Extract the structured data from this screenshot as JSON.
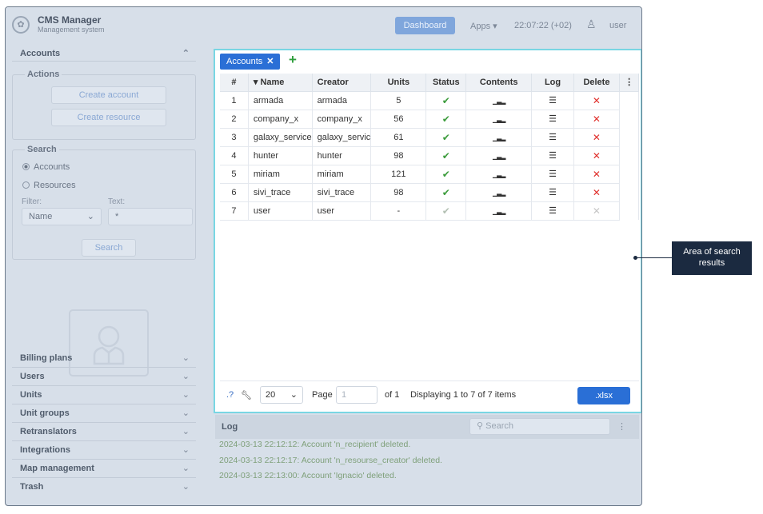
{
  "header": {
    "logo": "✿",
    "app_title": "CMS Manager",
    "app_subtitle": "Management system",
    "dashboard_label": "Dashboard",
    "apps_label": "Apps",
    "time": "22:07:22 (+02)",
    "user_name": "user"
  },
  "sidebar": {
    "accounts_label": "Accounts",
    "actions_legend": "Actions",
    "create_account": "Create account",
    "create_resource": "Create resource",
    "search_legend": "Search",
    "radio_accounts": "Accounts",
    "radio_resources": "Resources",
    "filter_label": "Filter:",
    "text_label": "Text:",
    "filter_value": "Name",
    "text_value": "*",
    "search_button": "Search",
    "nav": [
      "Billing plans",
      "Users",
      "Units",
      "Unit groups",
      "Retranslators",
      "Integrations",
      "Map management",
      "Trash"
    ]
  },
  "main": {
    "tab_label": "Accounts",
    "columns": [
      "#",
      "Name",
      "Creator",
      "Units",
      "Status",
      "Contents",
      "Log",
      "Delete"
    ],
    "rows": [
      {
        "n": "1",
        "name": "armada",
        "creator": "armada",
        "units": "5",
        "enabled": true
      },
      {
        "n": "2",
        "name": "company_x",
        "creator": "company_x",
        "units": "56",
        "enabled": true
      },
      {
        "n": "3",
        "name": "galaxy_service",
        "creator": "galaxy_servic",
        "units": "61",
        "enabled": true
      },
      {
        "n": "4",
        "name": "hunter",
        "creator": "hunter",
        "units": "98",
        "enabled": true
      },
      {
        "n": "5",
        "name": "miriam",
        "creator": "miriam",
        "units": "121",
        "enabled": true
      },
      {
        "n": "6",
        "name": "sivi_trace",
        "creator": "sivi_trace",
        "units": "98",
        "enabled": true
      },
      {
        "n": "7",
        "name": "user",
        "creator": "user",
        "units": "-",
        "enabled": false
      }
    ],
    "page_size": "20",
    "page_label": "Page",
    "page_value": "1",
    "of_label": "of 1",
    "displaying": "Displaying 1 to 7 of 7 items",
    "xlsx_label": ".xlsx"
  },
  "log": {
    "title": "Log",
    "search_placeholder": "Search",
    "lines": [
      "2024-03-13 22:12:12: Account 'n_recipient' deleted.",
      "2024-03-13 22:12:17: Account 'n_resourse_creator' deleted.",
      "2024-03-13 22:13:00: Account 'Ignacio' deleted."
    ]
  },
  "annotation": {
    "callout_text": "Area of search results"
  },
  "colors": {
    "accent": "#2a6fd6",
    "highlight_border": "#79d6e3",
    "ok": "#3a9b3a",
    "delete": "#e0302c",
    "callout_bg": "#1b2a40"
  }
}
